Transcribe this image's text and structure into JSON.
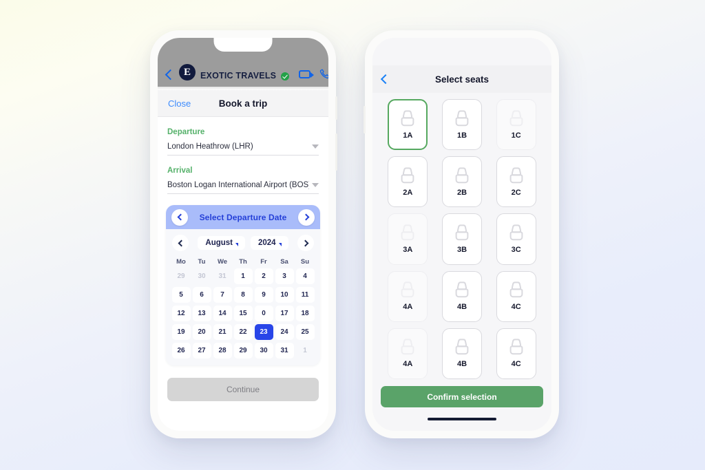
{
  "left_phone": {
    "call_header": {
      "back_icon": "chevron-left-icon",
      "logo_letter": "E",
      "brand": "EXOTIC TRAVELS",
      "verified_icon": "verified-badge-icon",
      "video_icon": "video-camera-icon",
      "phone_icon": "phone-icon"
    },
    "modal_bar": {
      "close_label": "Close",
      "title": "Book a trip"
    },
    "form": {
      "departure": {
        "label": "Departure",
        "value": "London Heathrow (LHR)",
        "caret_icon": "caret-down-icon"
      },
      "arrival": {
        "label": "Arrival",
        "value": "Boston Logan International Airport (BOS)",
        "caret_icon": "caret-down-icon"
      }
    },
    "calendar": {
      "topbar": {
        "title": "Select Departure Date",
        "prev_icon": "chevron-left-icon",
        "next_icon": "chevron-right-icon"
      },
      "month": "August",
      "year": "2024",
      "prev_month_icon": "chevron-left-icon",
      "next_month_icon": "chevron-right-icon",
      "weekdays": [
        "Mo",
        "Tu",
        "We",
        "Th",
        "Fr",
        "Sa",
        "Su"
      ],
      "selected_day": "23",
      "weeks": [
        [
          {
            "d": "29",
            "state": "muted"
          },
          {
            "d": "30",
            "state": "muted"
          },
          {
            "d": "31",
            "state": "muted"
          },
          {
            "d": "1",
            "state": "normal"
          },
          {
            "d": "2",
            "state": "normal"
          },
          {
            "d": "3",
            "state": "normal"
          },
          {
            "d": "4",
            "state": "normal"
          }
        ],
        [
          {
            "d": "5",
            "state": "normal"
          },
          {
            "d": "6",
            "state": "normal"
          },
          {
            "d": "7",
            "state": "normal"
          },
          {
            "d": "8",
            "state": "normal"
          },
          {
            "d": "9",
            "state": "normal"
          },
          {
            "d": "10",
            "state": "normal"
          },
          {
            "d": "11",
            "state": "normal"
          }
        ],
        [
          {
            "d": "12",
            "state": "normal"
          },
          {
            "d": "13",
            "state": "normal"
          },
          {
            "d": "14",
            "state": "normal"
          },
          {
            "d": "15",
            "state": "normal"
          },
          {
            "d": "0",
            "state": "normal"
          },
          {
            "d": "17",
            "state": "normal"
          },
          {
            "d": "18",
            "state": "normal"
          }
        ],
        [
          {
            "d": "19",
            "state": "normal"
          },
          {
            "d": "20",
            "state": "normal"
          },
          {
            "d": "21",
            "state": "normal"
          },
          {
            "d": "22",
            "state": "normal"
          },
          {
            "d": "23",
            "state": "selected"
          },
          {
            "d": "24",
            "state": "normal"
          },
          {
            "d": "25",
            "state": "normal"
          }
        ],
        [
          {
            "d": "26",
            "state": "normal"
          },
          {
            "d": "27",
            "state": "normal"
          },
          {
            "d": "28",
            "state": "normal"
          },
          {
            "d": "29",
            "state": "normal"
          },
          {
            "d": "30",
            "state": "normal"
          },
          {
            "d": "31",
            "state": "normal"
          },
          {
            "d": "1",
            "state": "muted"
          }
        ]
      ]
    },
    "continue_button": {
      "label": "Continue",
      "enabled": false
    }
  },
  "right_phone": {
    "header": {
      "back_icon": "chevron-left-icon",
      "title": "Select seats"
    },
    "seat_icon": "seat-icon",
    "seat_rows": [
      [
        {
          "label": "1A",
          "state": "selected"
        },
        {
          "label": "1B",
          "state": "available"
        },
        {
          "label": "1C",
          "state": "disabled"
        }
      ],
      [
        {
          "label": "2A",
          "state": "available"
        },
        {
          "label": "2B",
          "state": "available"
        },
        {
          "label": "2C",
          "state": "available"
        }
      ],
      [
        {
          "label": "3A",
          "state": "disabled"
        },
        {
          "label": "3B",
          "state": "available"
        },
        {
          "label": "3C",
          "state": "available"
        }
      ],
      [
        {
          "label": "4A",
          "state": "disabled"
        },
        {
          "label": "4B",
          "state": "available"
        },
        {
          "label": "4C",
          "state": "available"
        }
      ],
      [
        {
          "label": "4A",
          "state": "disabled"
        },
        {
          "label": "4B",
          "state": "available"
        },
        {
          "label": "4C",
          "state": "available"
        }
      ]
    ],
    "confirm_button": {
      "label": "Confirm selection"
    },
    "home_indicator": "home-indicator"
  },
  "colors": {
    "accent_green": "#55b16a",
    "accent_blue": "#2845e8",
    "link_blue": "#3d8bfd",
    "calendar_bar": "#a9bcfa",
    "confirm_green": "#5aa369",
    "disabled_gray": "#d5d5d5"
  }
}
